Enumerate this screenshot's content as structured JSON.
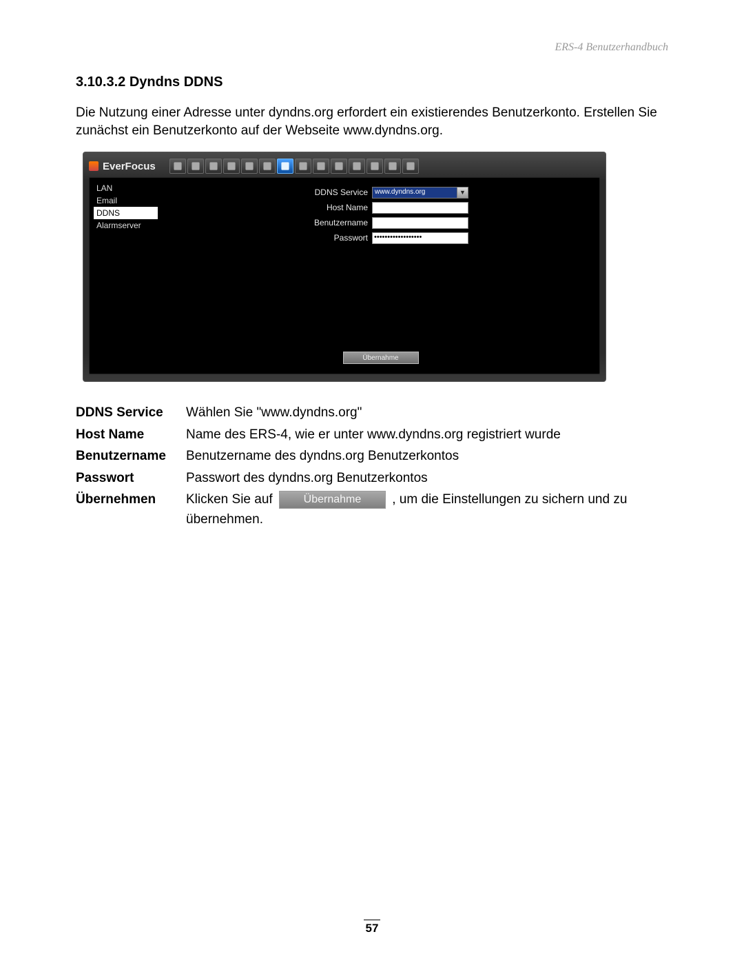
{
  "header": {
    "doc_title": "ERS-4  Benutzerhandbuch"
  },
  "section": {
    "number_title": "3.10.3.2 Dyndns DDNS",
    "para1": "Die Nutzung einer Adresse unter dyndns.org erfordert ein existierendes Benutzerkonto. Erstellen Sie zunächst ein Benutzerkonto auf der Webseite www.dyndns.org."
  },
  "screenshot": {
    "brand": "EverFocus",
    "sidebar": {
      "items": [
        "LAN",
        "Email",
        "DDNS",
        "Alarmserver"
      ],
      "selected_index": 2
    },
    "form": {
      "ddns_service_label": "DDNS Service",
      "ddns_service_value": "www.dyndns.org",
      "host_name_label": "Host Name",
      "host_name_value": "",
      "user_label": "Benutzername",
      "user_value": "",
      "password_label": "Passwort",
      "password_value": "••••••••••••••••••",
      "apply_label": "Übernahme"
    },
    "top_icons": [
      "keyboard-icon",
      "brush-icon",
      "arrows-icon",
      "grid-icon",
      "bell-icon",
      "minus-icon",
      "network-icon",
      "camera-icon",
      "monitor-icon",
      "gauge-icon",
      "gear-icon",
      "info-icon",
      "disk-icon",
      "search-icon"
    ],
    "active_icon_index": 6
  },
  "desc": {
    "rows": [
      {
        "label": "DDNS Service",
        "text": "Wählen Sie  \"www.dyndns.org\""
      },
      {
        "label": "Host Name",
        "text": "Name des ERS-4, wie er unter www.dyndns.org registriert wurde"
      },
      {
        "label": "Benutzername",
        "text": "Benutzername des dyndns.org Benutzerkontos"
      },
      {
        "label": "Passwort",
        "text": "Passwort des dyndns.org Benutzerkontos"
      }
    ],
    "apply_label": "Übernehmen",
    "apply_pre": "Klicken Sie auf ",
    "apply_btn": "Übernahme",
    "apply_post": " , um die Einstellungen zu sichern und zu übernehmen."
  },
  "page_number": "57"
}
